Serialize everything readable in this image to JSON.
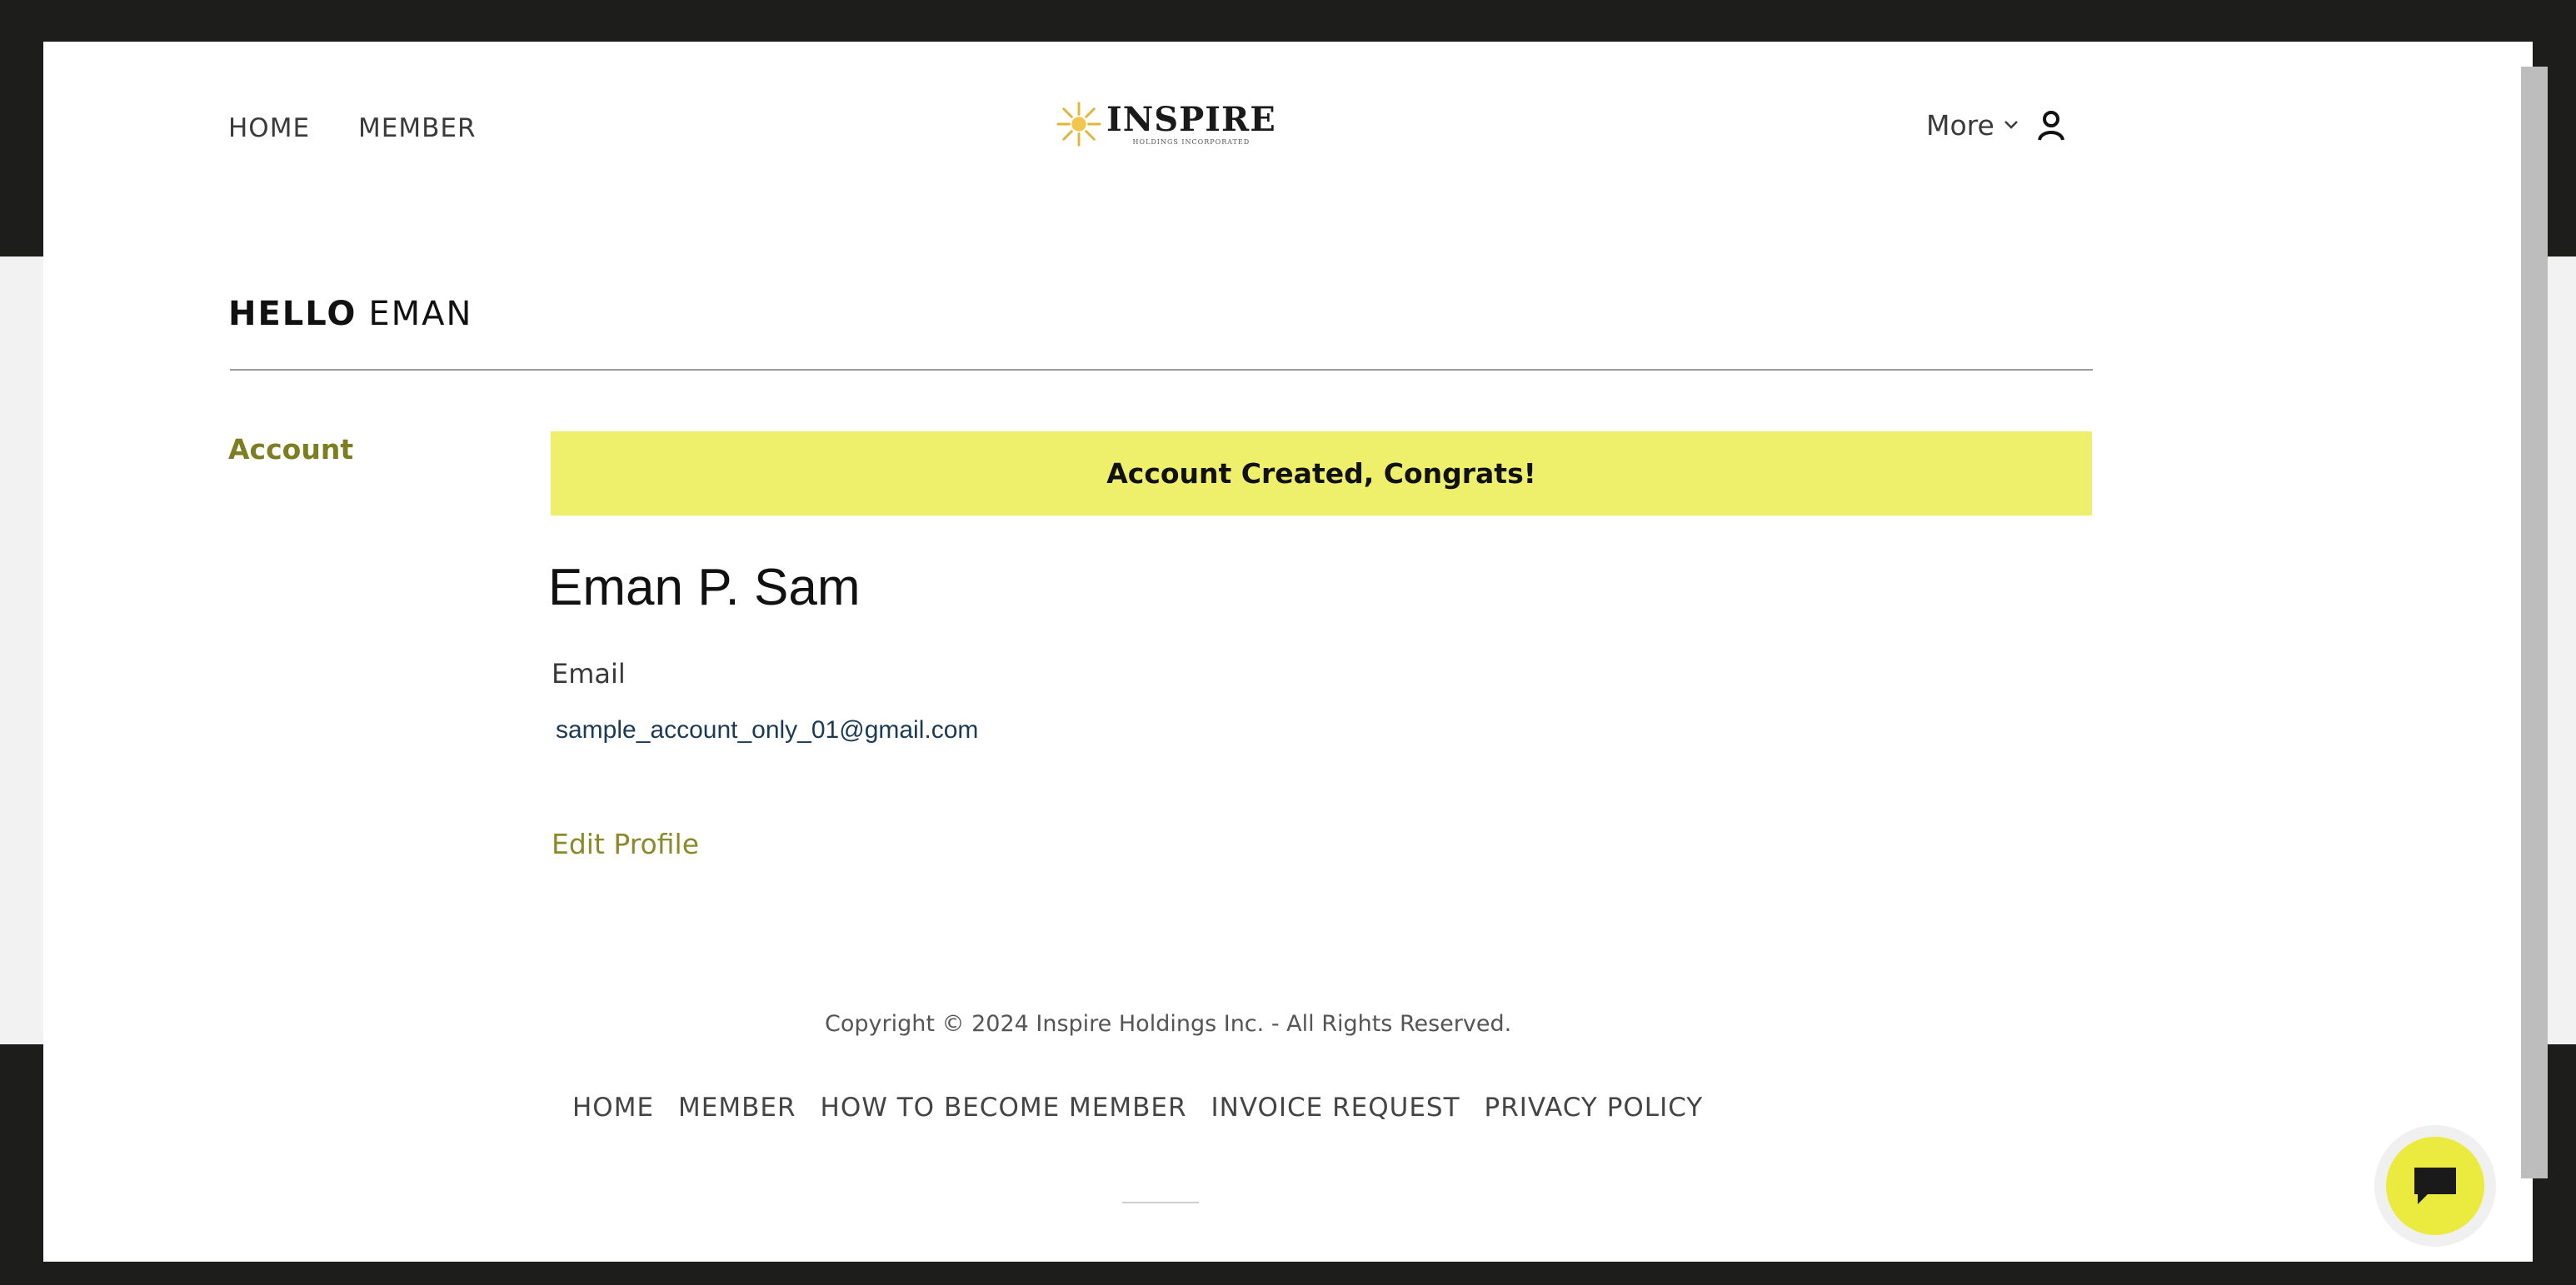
{
  "header": {
    "nav": [
      {
        "label": "HOME"
      },
      {
        "label": "MEMBER"
      }
    ],
    "logo": {
      "word": "INSPIRE",
      "tagline": "HOLDINGS INCORPORATED"
    },
    "more_label": "More"
  },
  "greeting": {
    "hello": "HELLO",
    "name": "EMAN"
  },
  "sidebar": {
    "account_label": "Account"
  },
  "main": {
    "banner": "Account Created, Congrats!",
    "full_name": "Eman P. Sam",
    "email_label": "Email",
    "email_value": "sample_account_only_01@gmail.com",
    "edit_profile": "Edit Profile"
  },
  "footer": {
    "copyright": "Copyright © 2024 Inspire Holdings Inc. - All Rights Reserved.",
    "links": [
      {
        "label": "HOME"
      },
      {
        "label": "MEMBER"
      },
      {
        "label": "HOW TO BECOME MEMBER"
      },
      {
        "label": "INVOICE REQUEST"
      },
      {
        "label": "PRIVACY POLICY"
      }
    ]
  },
  "colors": {
    "accent_olive": "#7d7d22",
    "banner_yellow": "#eef06c",
    "chat_yellow": "#ebea3e",
    "frame_dark": "#1d1d1b"
  },
  "icons": [
    "sun-logo-icon",
    "chevron-down-icon",
    "user-icon",
    "chat-icon"
  ]
}
